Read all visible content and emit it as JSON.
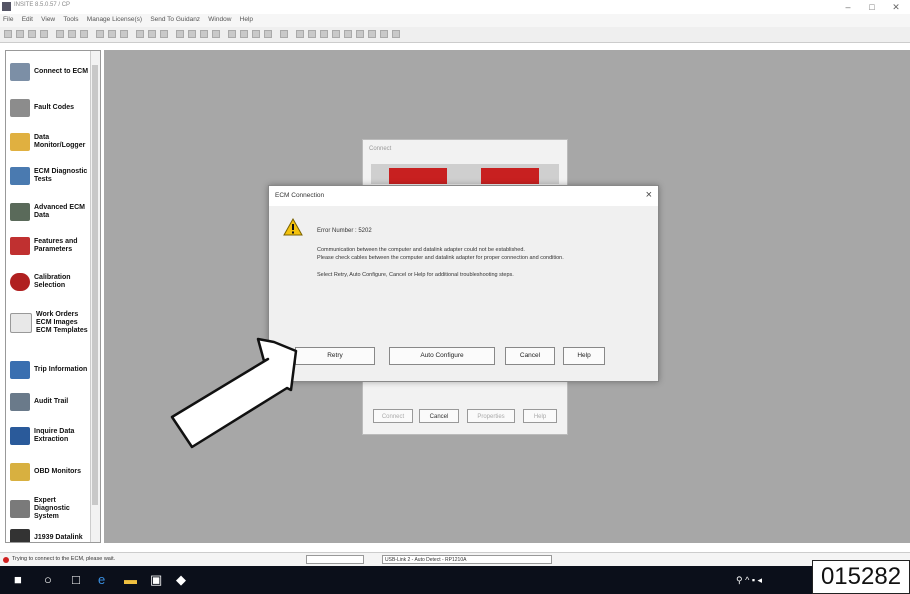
{
  "window": {
    "title": "INSITE 8.5.0.57 / CP",
    "minimize_icon": "minimize-icon",
    "maximize_icon": "maximize-icon",
    "close_icon": "close-icon"
  },
  "menu": [
    "File",
    "Edit",
    "View",
    "Tools",
    "Manage License(s)",
    "Send To Guidanz",
    "Window",
    "Help"
  ],
  "sidebar": {
    "items": [
      {
        "label": "Connect to ECM",
        "icon": "connect-icon"
      },
      {
        "label": "Fault Codes",
        "icon": "fault-codes-icon"
      },
      {
        "label": "Data\nMonitor/Logger",
        "icon": "monitor-icon"
      },
      {
        "label": "ECM Diagnostic\nTests",
        "icon": "diagnostic-icon"
      },
      {
        "label": "Advanced ECM\nData",
        "icon": "advanced-data-icon"
      },
      {
        "label": "Features and\nParameters",
        "icon": "features-icon"
      },
      {
        "label": "Calibration\nSelection",
        "icon": "calibration-icon"
      },
      {
        "label": "Work Orders\nECM Images\nECM Templates",
        "icon": "work-orders-icon"
      },
      {
        "label": "Trip Information",
        "icon": "trip-icon"
      },
      {
        "label": "Audit Trail",
        "icon": "audit-icon"
      },
      {
        "label": "Inquire Data\nExtraction",
        "icon": "inquire-icon"
      },
      {
        "label": "OBD Monitors",
        "icon": "obd-icon"
      },
      {
        "label": "Expert\nDiagnostic\nSystem",
        "icon": "expert-icon"
      },
      {
        "label": "J1939 Datalink",
        "icon": "datalink-icon"
      }
    ]
  },
  "connect_window": {
    "title": "Connect",
    "buttons": [
      "Connect",
      "Cancel",
      "Properties",
      "Help"
    ]
  },
  "dialog": {
    "title": "ECM Connection",
    "error_number": "Error Number : 5202",
    "message_line1": "Communication between the computer and datalink adapter could not be established.",
    "message_line2": "Please check cables between the computer and datalink adapter for proper connection and condition.",
    "message_line3": "Select Retry, Auto Configure, Cancel or Help for additional troubleshooting steps.",
    "buttons": {
      "retry": "Retry",
      "auto_configure": "Auto Configure",
      "cancel": "Cancel",
      "help": "Help"
    },
    "warning_icon": "warning-icon"
  },
  "statusbar": {
    "message": "Trying to connect to the ECM, please wait.",
    "adapter": "USB-Link 2 - Auto Detect - RP1210A"
  },
  "reference_number": "015282",
  "colors": {
    "workspace": "#a7a7a7",
    "dialog": "#f0f0f0",
    "taskbar": "#0b0f1a",
    "warning": "#f4c20d",
    "accent_red": "#c82020"
  }
}
